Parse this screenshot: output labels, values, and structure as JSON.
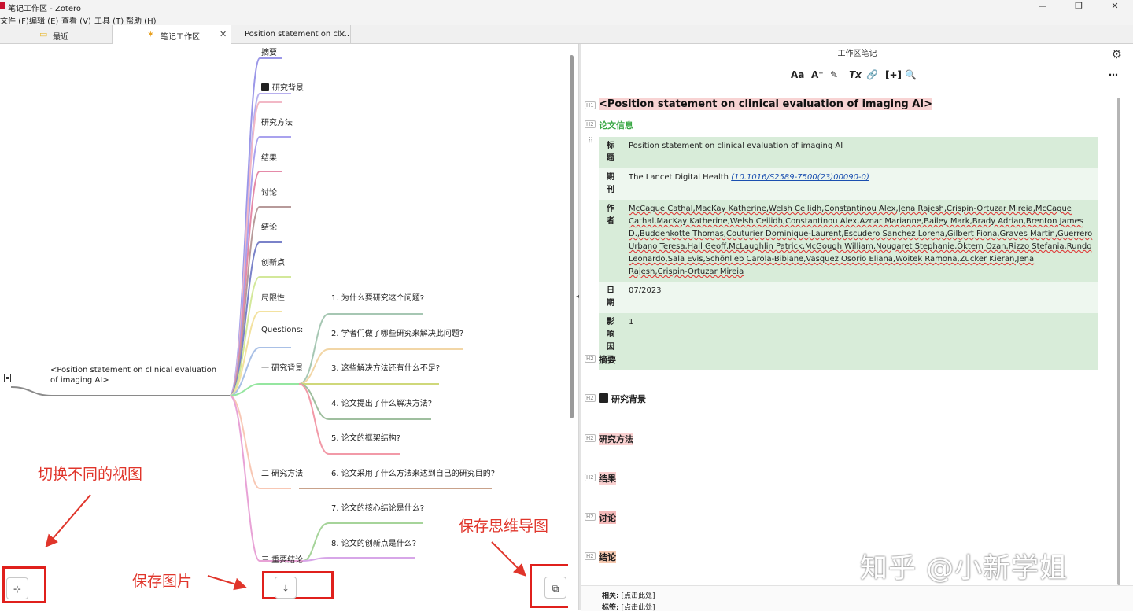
{
  "window": {
    "title": "笔记工作区 - Zotero",
    "minimize_glyph": "—",
    "maximize_glyph": "❐",
    "close_glyph": "✕"
  },
  "menu": [
    "文件 (F)",
    "编辑 (E)",
    "查看 (V)",
    "工具 (T)",
    "帮助 (H)"
  ],
  "tabs": [
    {
      "label": "最近",
      "icon": "folder-icon"
    },
    {
      "label": "笔记工作区",
      "icon": "spark-icon",
      "close": "✕",
      "active": true
    },
    {
      "label": "Position statement on cli...",
      "close": "✕"
    }
  ],
  "mindmap": {
    "root": "<Position statement on clinical evaluation of imaging AI>",
    "branches": [
      "摘要",
      "研究背景",
      "研究方法",
      "结果",
      "讨论",
      "结论",
      "创新点",
      "局限性",
      "Questions:",
      "一 研究背景",
      "二 研究方法",
      "三 重要结论"
    ],
    "questions": [
      "1. 为什么要研究这个问题?",
      "2. 学者们做了哪些研究来解决此问题?",
      "3. 这些解决方法还有什么不足?",
      "4. 论文提出了什么解决方法?",
      "5. 论文的框架结构?",
      "6. 论文采用了什么方法来达到自己的研究目的?",
      "7. 论文的核心结论是什么?",
      "8. 论文的创新点是什么?"
    ],
    "colors": {
      "trunk": "#8a8a8a",
      "branches": [
        "#9b97e8",
        "#b8b0ef",
        "#f2b8c6",
        "#a9a2ee",
        "#e58aa8",
        "#b79a9a",
        "#7a82c9",
        "#d3e89a",
        "#f3e2a0",
        "#a9c0e6",
        "#95e6a0",
        "#f8c7b4",
        "#e8a2d6"
      ],
      "questions": [
        "#a6c7b3",
        "#f2d6a6",
        "#cfd87a",
        "#9fbf9f",
        "#f29aa8",
        "#c9a28b",
        "#a6d49a",
        "#d7a6e8"
      ]
    },
    "switch_view_icon": "tree-view-icon",
    "save_image_icon": "download-icon",
    "save_mindmap_icon": "mindmap-save-icon"
  },
  "annotations": {
    "switch_view": "切换不同的视图",
    "save_image": "保存图片",
    "save_mindmap": "保存思维导图",
    "color": "#e0352b"
  },
  "note": {
    "header": "工作区笔记",
    "toolbar": [
      "Aa",
      "A⁺",
      "✎",
      "Tx",
      "🔗",
      "[+]",
      "🔍",
      "⋯"
    ],
    "h1_badge": "H1",
    "h2_badge": "H2",
    "h1": "<Position statement on clinical evaluation of imaging AI>",
    "paper_info": "论文信息",
    "meta": [
      {
        "key": "标题",
        "value": "Position statement on clinical evaluation of imaging AI"
      },
      {
        "key": "期刊",
        "journal": "The Lancet Digital Health ",
        "doi": "(10.1016/S2589-7500(23)00090-0)"
      },
      {
        "key": "作者",
        "value": "McCague Cathal,MacKay Katherine,Welsh Ceilidh,Constantinou Alex,Jena Rajesh,Crispin-Ortuzar Mireia,McCague Cathal,MacKay Katherine,Welsh Ceilidh,Constantinou Alex,Aznar Marianne,Bailey Mark,Brady Adrian,Brenton James D.,Buddenkotte Thomas,Couturier Dominique-Laurent,Escudero Sanchez Lorena,Gilbert Fiona,Graves Martin,Guerrero Urbano Teresa,Hall Geoff,McLaughlin Patrick,McGough William,Nougaret Stephanie,Öktem Ozan,Rizzo Stefania,Rundo Leonardo,Sala Evis,Schönlieb Carola-Bibiane,Vasquez Osorio Eliana,Woitek Ramona,Zucker Kieran,Jena Rajesh,Crispin-Ortuzar Mireia"
      },
      {
        "key": "日期",
        "value": "07/2023"
      },
      {
        "key": "影响因子",
        "value": "1"
      }
    ],
    "headings": [
      "摘要",
      "研究背景",
      "研究方法",
      "结果",
      "讨论",
      "结论"
    ],
    "heading_colors": [
      "#ffffff",
      "#ffffff",
      "#f9d0d0",
      "#f9d0d0",
      "#f4b8b8",
      "#f6c9b0"
    ],
    "footer": {
      "related_label": "相关:",
      "related_value": "[点击此处]",
      "tags_label": "标签:",
      "tags_value": "[点击此处]"
    }
  },
  "watermark": "知乎 @小新学姐"
}
